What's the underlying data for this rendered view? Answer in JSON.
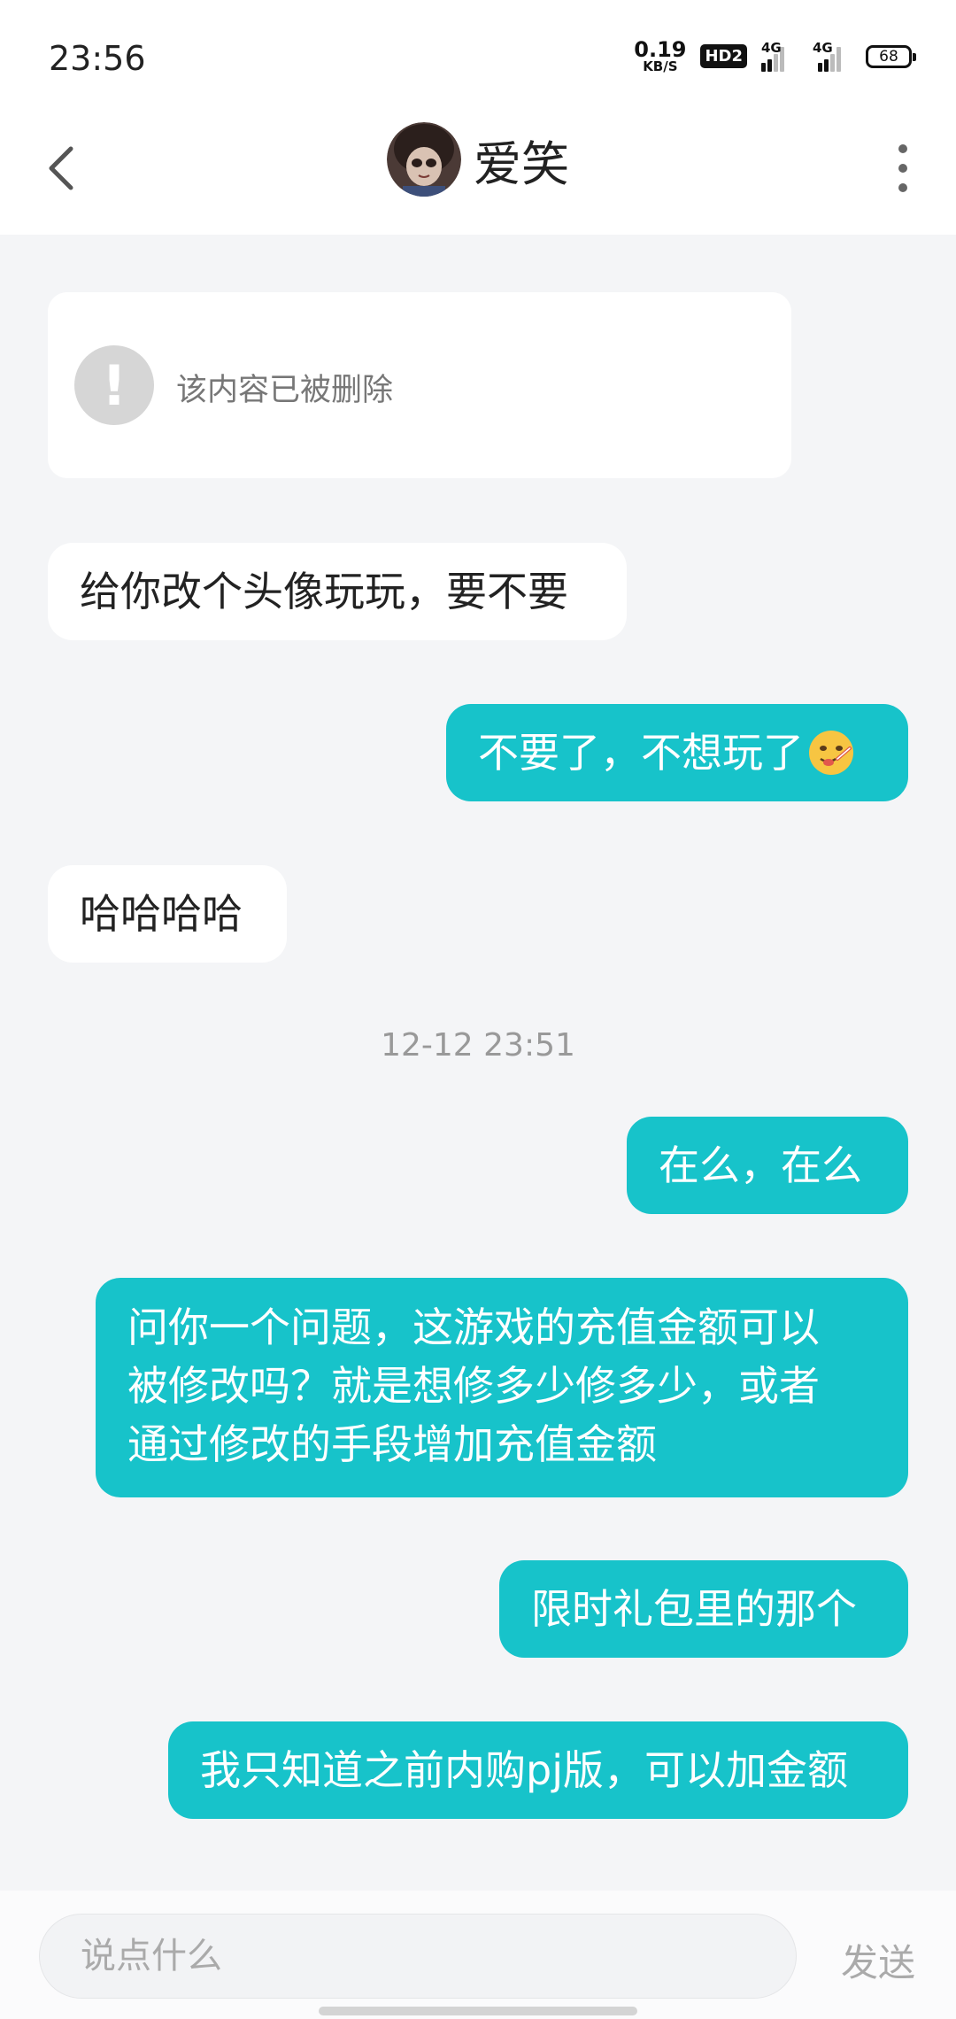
{
  "status_bar": {
    "time": "23:56",
    "net_speed": "0.19",
    "net_speed_unit": "KB/S",
    "hd": "HD2",
    "signal1": "4G",
    "signal2": "4G",
    "battery": "68"
  },
  "header": {
    "contact_name": "爱笑"
  },
  "messages": {
    "deleted_notice": "该内容已被删除",
    "m1": "给你改个头像玩玩，要不要",
    "m2": "不要了，不想玩了",
    "m2_emoji": "sick-thermometer-face-emoji",
    "m3": "哈哈哈哈",
    "timestamp": "12-12 23:51",
    "m4": "在么，在么",
    "m5_lines": [
      "问你一个问题，这游戏的充值金额可以",
      "被修改吗？就是想修多少修多少，或者",
      "通过修改的手段增加充值金额"
    ],
    "m6": "限时礼包里的那个",
    "m7": "我只知道之前内购pj版，可以加金额"
  },
  "input": {
    "placeholder": "说点什么",
    "send_label": "发送"
  },
  "colors": {
    "outgoing_bubble": "#17c3ca",
    "incoming_bubble": "#ffffff",
    "background": "#f4f5f7"
  }
}
